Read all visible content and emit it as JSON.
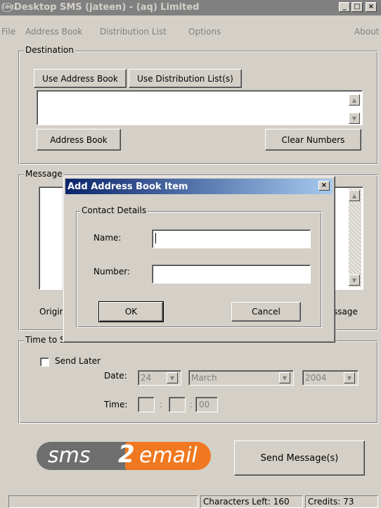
{
  "window": {
    "title": "Desktop SMS (jateen) - (aq) Limited",
    "app_icon_text": "(aq)",
    "minimize": "_",
    "maximize": "□",
    "close": "×"
  },
  "menu": [
    "File",
    "Address Book",
    "Distribution List",
    "Options",
    "About"
  ],
  "destination": {
    "label": "Destination",
    "tab_address_book": "Use Address Book",
    "tab_distribution": "Use Distribution List(s)",
    "address_book_button": "Address Book",
    "clear_numbers_button": "Clear Numbers"
  },
  "message": {
    "label": "Message",
    "originator_partial": "Origir",
    "message_partial": "ssage"
  },
  "time_to_send": {
    "label": "Time to Send",
    "send_later": "Send Later",
    "date_label": "Date:",
    "day": "24",
    "month": "March",
    "year": "2004",
    "time_label": "Time:",
    "sep1": ":",
    "sep2": ":",
    "seconds": "00"
  },
  "logo": {
    "part1": "sms",
    "part2": "2",
    "part3": "email"
  },
  "send_button": "Send Message(s)",
  "status": {
    "chars_left": "Characters Left: 160",
    "credits": "Credits: 73"
  },
  "dialog": {
    "title": "Add Address Book Item",
    "close": "×",
    "group_label": "Contact Details",
    "name_label": "Name:",
    "name_value": "",
    "number_label": "Number:",
    "number_value": "",
    "ok": "OK",
    "cancel": "Cancel"
  },
  "colors": {
    "title_inactive": "#808080",
    "dialog_title_start": "#0a246a",
    "logo_orange": "#f07820",
    "logo_gray": "#6e6e6e"
  }
}
